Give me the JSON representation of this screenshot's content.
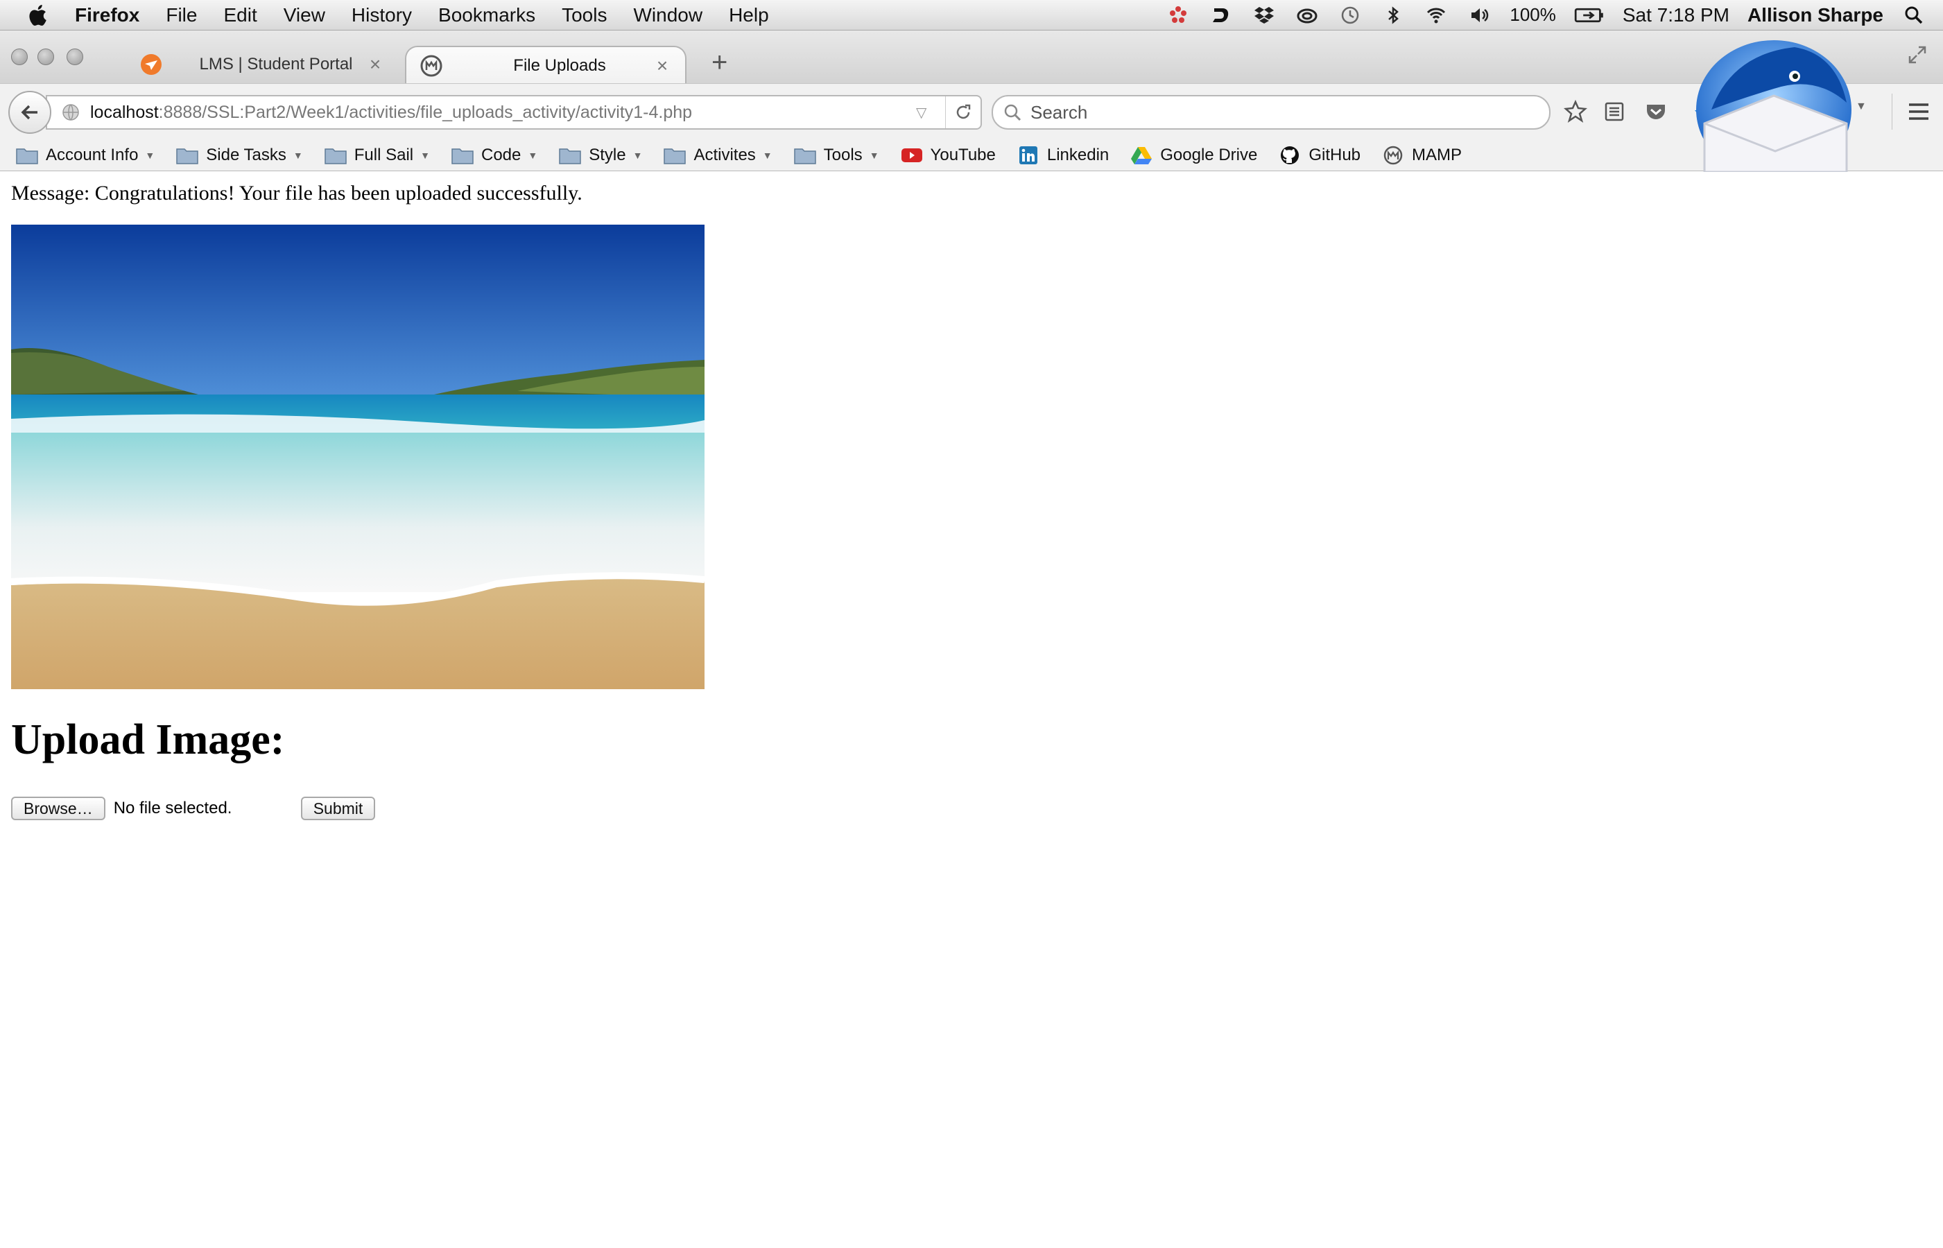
{
  "menubar": {
    "app_name": "Firefox",
    "items": [
      "File",
      "Edit",
      "View",
      "History",
      "Bookmarks",
      "Tools",
      "Window",
      "Help"
    ],
    "battery": "100%",
    "clock": "Sat 7:18 PM",
    "user": "Allison Sharpe"
  },
  "tabs": [
    {
      "label": "LMS | Student Portal",
      "icon": "fullsail-icon",
      "active": false
    },
    {
      "label": "File Uploads",
      "icon": "mamp-icon",
      "active": true
    }
  ],
  "navbar": {
    "url_host": "localhost",
    "url_path": ":8888/SSL:Part2/Week1/activities/file_uploads_activity/activity1-4.php",
    "search_placeholder": "Search"
  },
  "bookmarks": [
    {
      "label": "Account Info",
      "type": "folder"
    },
    {
      "label": "Side Tasks",
      "type": "folder"
    },
    {
      "label": "Full Sail",
      "type": "folder"
    },
    {
      "label": "Code",
      "type": "folder"
    },
    {
      "label": "Style",
      "type": "folder"
    },
    {
      "label": "Activites",
      "type": "folder"
    },
    {
      "label": "Tools",
      "type": "folder"
    },
    {
      "label": "YouTube",
      "type": "link",
      "icon": "youtube-icon"
    },
    {
      "label": "Linkedin",
      "type": "link",
      "icon": "linkedin-icon"
    },
    {
      "label": "Google Drive",
      "type": "link",
      "icon": "google-drive-icon"
    },
    {
      "label": "GitHub",
      "type": "link",
      "icon": "github-icon"
    },
    {
      "label": "MAMP",
      "type": "link",
      "icon": "mamp-icon"
    }
  ],
  "page": {
    "message": "Message: Congratulations! Your file has been uploaded successfully.",
    "heading": "Upload Image:",
    "browse_label": "Browse…",
    "file_status": "No file selected.",
    "submit_label": "Submit"
  },
  "colors": {
    "sky_top": "#0d3f9e",
    "sea": "#1aa0c4",
    "sand": "#d9b77e"
  }
}
